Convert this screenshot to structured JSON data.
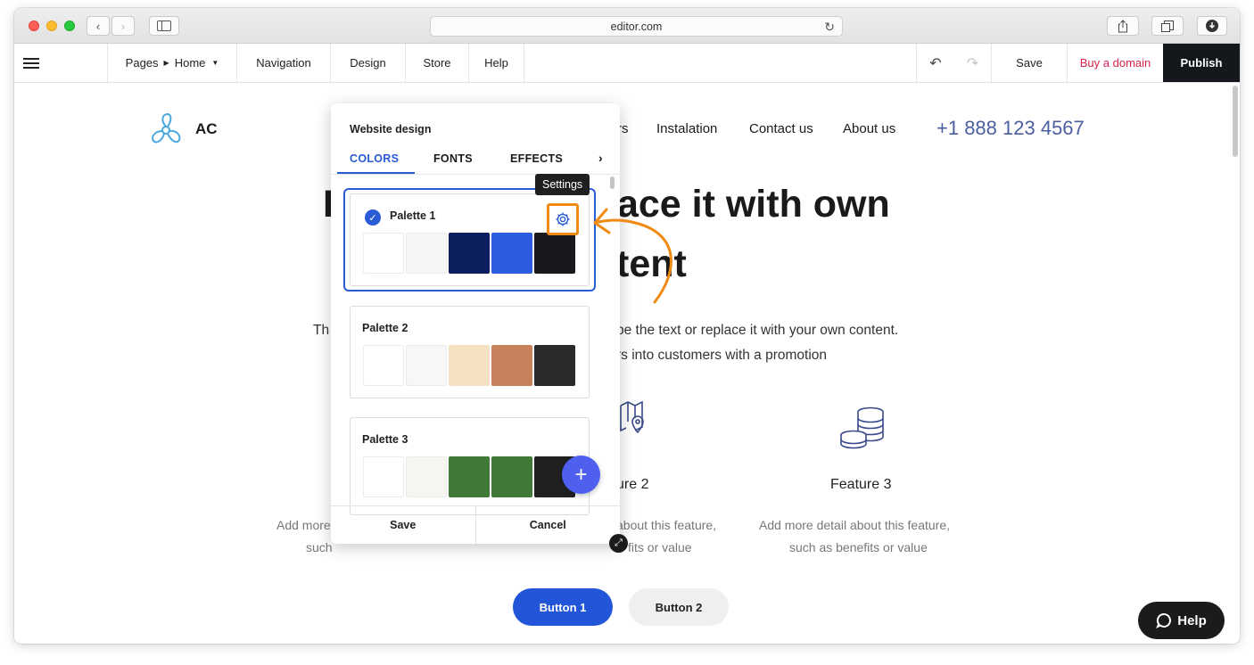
{
  "browser": {
    "address": "editor.com"
  },
  "toolbar": {
    "pages_label": "Pages",
    "home_label": "Home",
    "navigation_label": "Navigation",
    "design_label": "Design",
    "store_label": "Store",
    "help_label": "Help",
    "save_label": "Save",
    "domain_label": "Buy a domain",
    "publish_label": "Publish"
  },
  "site": {
    "logo_text": "AC",
    "nav": [
      "rs",
      "Instalation",
      "Contact us",
      "About us"
    ],
    "phone": "+1 888 123 4567",
    "hero_line1": "I",
    "hero_line1b": "ace it with own",
    "hero_line2": "tent",
    "sub_line1a": "Th",
    "sub_line1b": "pe the text or replace it with your own content.",
    "sub_line2": "rs into customers with a promotion",
    "features": [
      {
        "title": "ure 2",
        "desc1": "about this feature,",
        "desc2": "fits or value"
      },
      {
        "title": "Feature 3",
        "desc1": "Add more detail about this feature,",
        "desc2": "such as benefits or value"
      }
    ],
    "left_desc1": "Add more",
    "left_desc2": "such",
    "button1": "Button 1",
    "button2": "Button 2",
    "help_fab": "Help"
  },
  "panel": {
    "title": "Website design",
    "tabs": [
      "COLORS",
      "FONTS",
      "EFFECTS"
    ],
    "more": "›",
    "tooltip": "Settings",
    "palettes": [
      {
        "name": "Palette 1",
        "selected": true,
        "colors": [
          "#ffffff",
          "#f6f6f6",
          "#0c1e5e",
          "#2c5ce0",
          "#17191c"
        ]
      },
      {
        "name": "Palette 2",
        "selected": false,
        "colors": [
          "#ffffff",
          "#f7f7f7",
          "#f4e2c3",
          "#c9805d",
          "#2a2a2a"
        ]
      },
      {
        "name": "Palette 3",
        "selected": false,
        "colors": [
          "#ffffff",
          "#f6f5f2",
          "#3e7a36",
          "#3e7a36",
          "#202020"
        ]
      }
    ],
    "save": "Save",
    "cancel": "Cancel"
  },
  "colors": {
    "accent": "#2a5bd7",
    "publish_bg": "#14171c",
    "domain": "#d7234d",
    "annotation": "#f08a13"
  }
}
